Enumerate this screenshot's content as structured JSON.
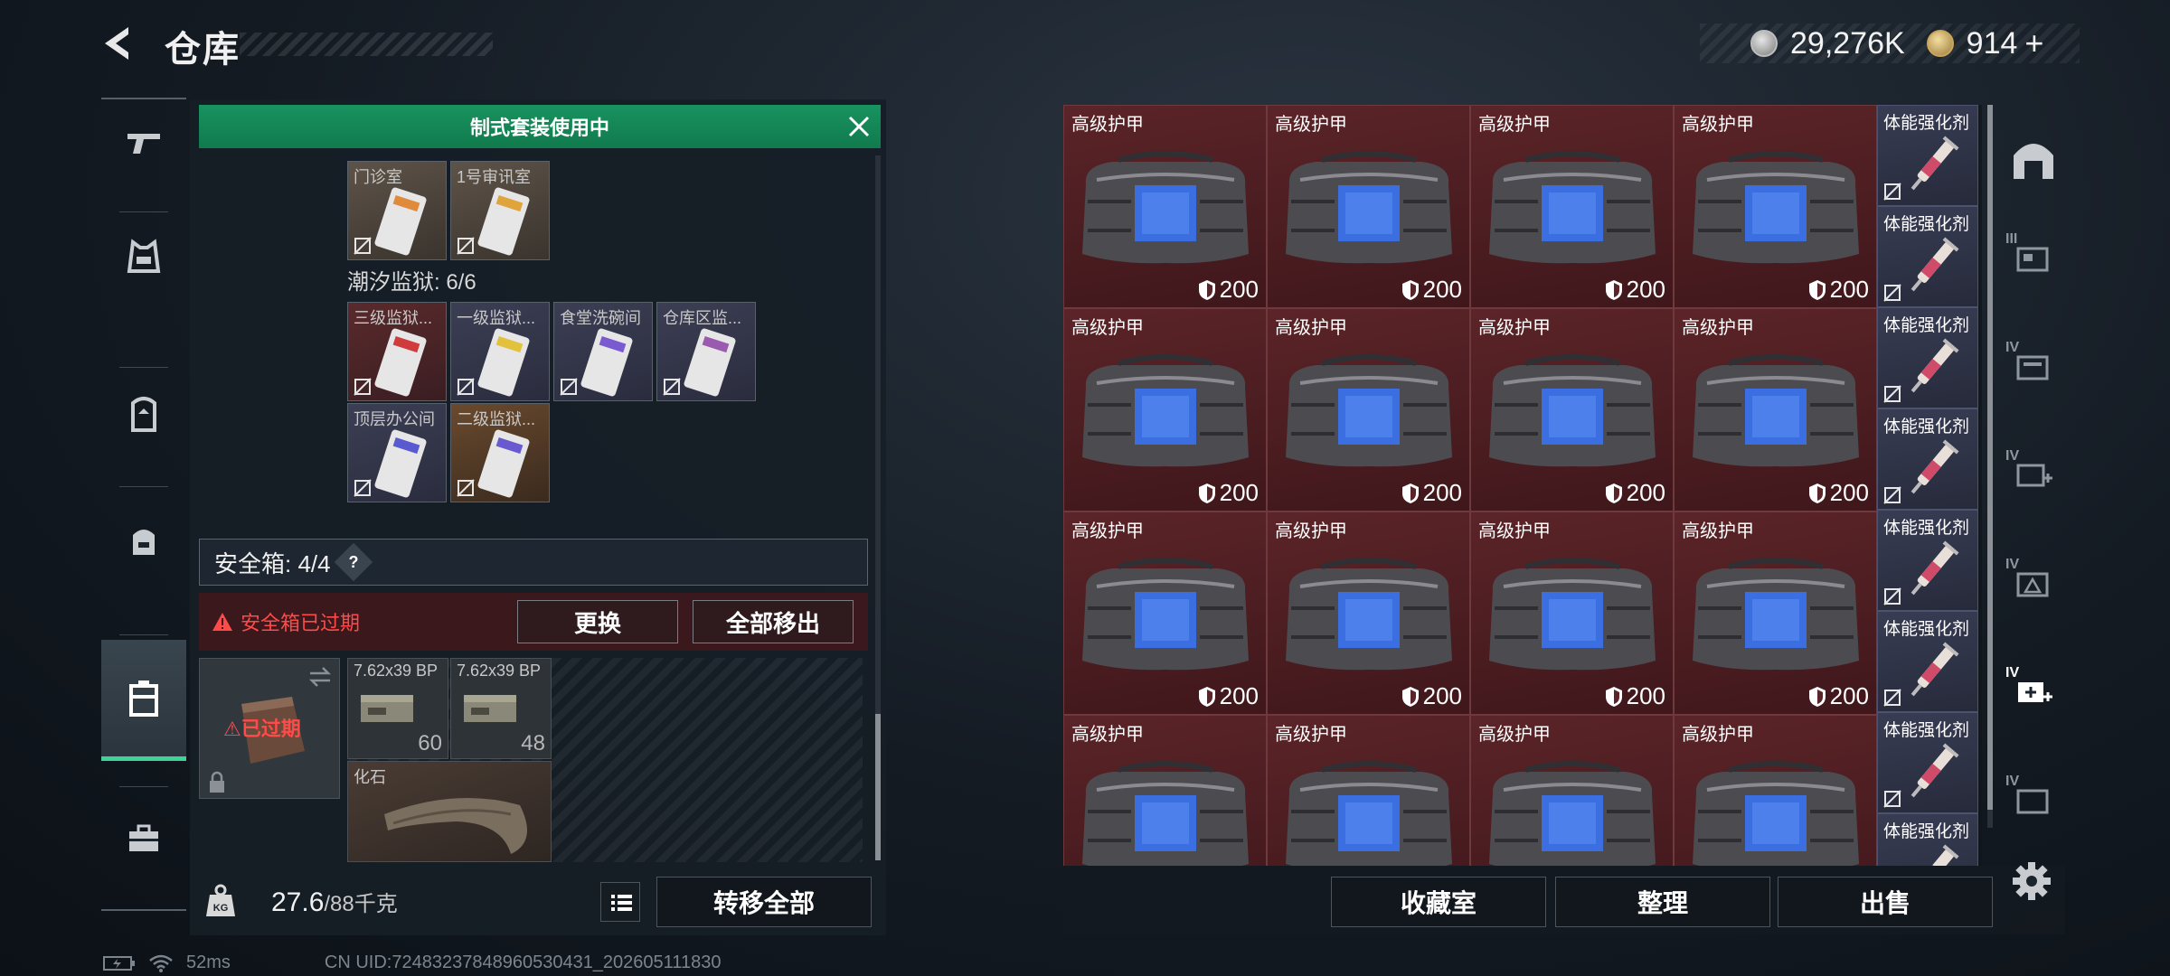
{
  "header": {
    "title": "仓库",
    "currency_silver": "29,276K",
    "currency_gold": "914",
    "plus": "+"
  },
  "suit_banner": "制式套装使用中",
  "keys_row1": [
    {
      "label": "门诊室"
    },
    {
      "label": "1号审讯室"
    }
  ],
  "prison_label": "潮汐监狱: 6/6",
  "prison_keys": [
    {
      "label": "三级监狱...",
      "color": "red"
    },
    {
      "label": "一级监狱...",
      "color": "purple"
    },
    {
      "label": "食堂洗碗间",
      "color": "purple"
    },
    {
      "label": "仓库区监...",
      "color": "purple"
    },
    {
      "label": "顶层办公间",
      "color": "purple"
    },
    {
      "label": "二级监狱...",
      "color": "orange"
    }
  ],
  "safebox": {
    "header": "安全箱: 4/4",
    "help": "?",
    "expired_warning": "安全箱已过期",
    "replace_btn": "更换",
    "move_all_btn": "全部移出",
    "item_status": "已过期",
    "items": [
      {
        "name": "7.62x39 BP",
        "count": "60"
      },
      {
        "name": "7.62x39 BP",
        "count": "48"
      }
    ],
    "fossil": "化石"
  },
  "footer_left": {
    "weight_current": "27.6",
    "weight_max": "/88千克",
    "transfer_all": "转移全部"
  },
  "warehouse": {
    "armor_label": "高级护甲",
    "armor_value": "200",
    "consumable_label": "体能强化剂"
  },
  "footer_right": {
    "collection_btn": "收藏室",
    "sort_btn": "整理",
    "sell_btn": "出售"
  },
  "right_nav": [
    "",
    "III",
    "IV",
    "IV",
    "IV",
    "IV",
    "IV"
  ],
  "status": {
    "ping": "52ms",
    "uid": "CN UID:72483237848960530431_202605111830"
  },
  "colors": {
    "accent_green": "#18935f",
    "expired_red": "#ff4a4a",
    "armor_bg": "#5b2428"
  }
}
